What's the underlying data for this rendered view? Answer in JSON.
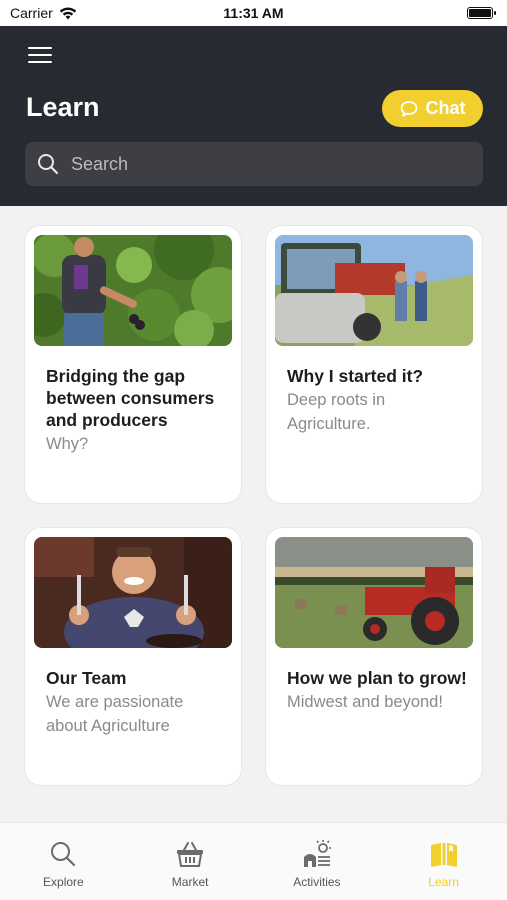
{
  "status": {
    "carrier": "Carrier",
    "time": "11:31 AM"
  },
  "header": {
    "title": "Learn",
    "chat_label": "Chat",
    "search_placeholder": "Search"
  },
  "cards": [
    {
      "title": "Bridging the gap between consumers and producers",
      "subtitle": "Why?",
      "image": "person-picking-grapes"
    },
    {
      "title": "Why I started it?",
      "subtitle": "Deep roots in Agriculture.",
      "image": "farmers-with-hay-equipment"
    },
    {
      "title": "Our Team",
      "subtitle": "We are passionate about Agriculture",
      "image": "man-with-fork-and-knife"
    },
    {
      "title": "How we plan to grow!",
      "subtitle": "Midwest and beyond!",
      "image": "red-tractor-in-field"
    }
  ],
  "tabs": [
    {
      "label": "Explore",
      "icon": "search-icon",
      "active": false
    },
    {
      "label": "Market",
      "icon": "basket-icon",
      "active": false
    },
    {
      "label": "Activities",
      "icon": "farm-sun-icon",
      "active": false
    },
    {
      "label": "Learn",
      "icon": "book-icon",
      "active": true
    }
  ],
  "colors": {
    "header": "#272a30",
    "accent": "#f0cf2f",
    "background": "#f2f2f2"
  }
}
